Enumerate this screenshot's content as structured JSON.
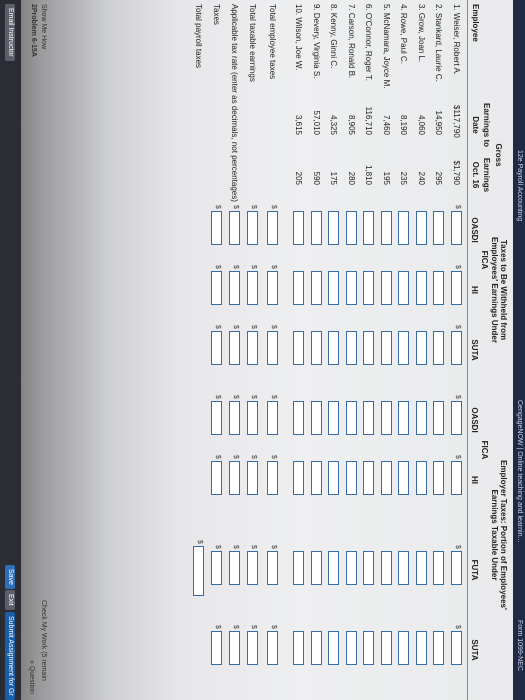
{
  "browser": {
    "breadcrumb_left": "12e Payroll Accounting",
    "breadcrumb_mid": "CengageNOW | Online teaching and learnin...",
    "breadcrumb_right": "Form 1099-NEC"
  },
  "table": {
    "col_employee": "Employee",
    "col_gross_top": "Gross",
    "col_earnings_to": "Earnings to",
    "col_date": "Date",
    "col_earnings": "Earnings",
    "col_oct16": "Oct. 16",
    "withheld_title_1": "Taxes to Be Withheld from",
    "withheld_title_2": "Employees' Earnings Under",
    "fica": "FICA",
    "oasdi": "OASDI",
    "hi": "HI",
    "suta": "SUTA",
    "employer_title_1": "Employer Taxes: Portion of Employees'",
    "employer_title_2": "Earnings Taxable Under",
    "employer_fica": "FICA",
    "employer_oasdi": "OASDI",
    "employer_hi": "HI",
    "futa": "FUTA",
    "employer_suta": "SUTA"
  },
  "employees": [
    {
      "name": "1. Weiser, Robert A.",
      "to_date": "$117,790",
      "oct16": "$1,790"
    },
    {
      "name": "2. Stankard, Laurie C.",
      "to_date": "14,950",
      "oct16": "295"
    },
    {
      "name": "3. Grow, Joan L.",
      "to_date": "4,060",
      "oct16": "240"
    },
    {
      "name": "4. Rowe, Paul C.",
      "to_date": "8,190",
      "oct16": "235"
    },
    {
      "name": "5. McNamara, Joyce M.",
      "to_date": "7,460",
      "oct16": "195"
    },
    {
      "name": "6. O'Connor, Roger T.",
      "to_date": "116,710",
      "oct16": "1,810"
    },
    {
      "name": "7. Carson, Ronald B.",
      "to_date": "8,905",
      "oct16": "280"
    },
    {
      "name": "8. Kenny, Ginni C.",
      "to_date": "4,325",
      "oct16": "175"
    },
    {
      "name": "9. Devery, Virginia S.",
      "to_date": "57,010",
      "oct16": "590"
    },
    {
      "name": "10. Wilson, Joe W.",
      "to_date": "3,615",
      "oct16": "205"
    }
  ],
  "totals": {
    "total_taxes": "Total employee taxes",
    "total_taxable": "Total taxable earnings",
    "rate": "Applicable tax rate (enter as decimals, not percentages)",
    "taxes": "Taxes",
    "total_payroll": "Total payroll taxes"
  },
  "footer": {
    "feedback": "Check My Work (5 remain",
    "show_key": "Show Me How",
    "problem": "2Problem 6-15A",
    "question": "« Question",
    "email_instructor": "Email Instructor",
    "save": "Save",
    "exit": "Exit",
    "submit": "Submit Assignment for Gr"
  }
}
